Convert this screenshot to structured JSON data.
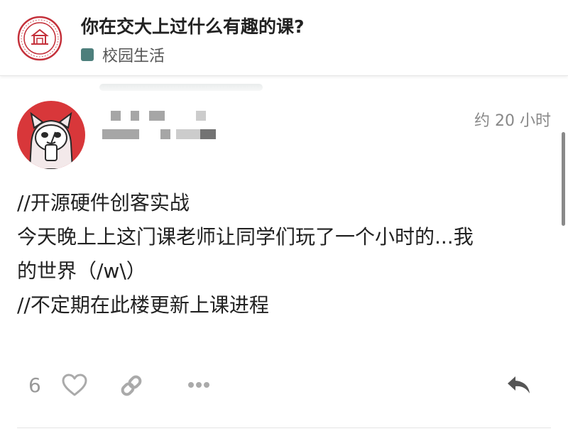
{
  "topic": {
    "title": "你在交大上过什么有趣的课?",
    "category": {
      "label": "校园生活",
      "color": "#4d7f7c"
    },
    "logo_icon": "university-seal-icon"
  },
  "post": {
    "avatar_icon": "cartoon-cat-avatar-icon",
    "timestamp": "约 20 小时",
    "lines": [
      "//开源硬件创客实战",
      "今天晚上上这门课老师让同学们玩了一个小时的...我",
      "的世界（/w\\）",
      "//不定期在此楼更新上课进程"
    ],
    "like_count": "6"
  },
  "icons": {
    "heart": "heart-icon",
    "link": "link-icon",
    "more": "more-icon",
    "reply": "reply-icon"
  },
  "colors": {
    "accent_red": "#d8373a",
    "muted_icon": "#aaaaaa",
    "reply_icon": "#555555"
  }
}
